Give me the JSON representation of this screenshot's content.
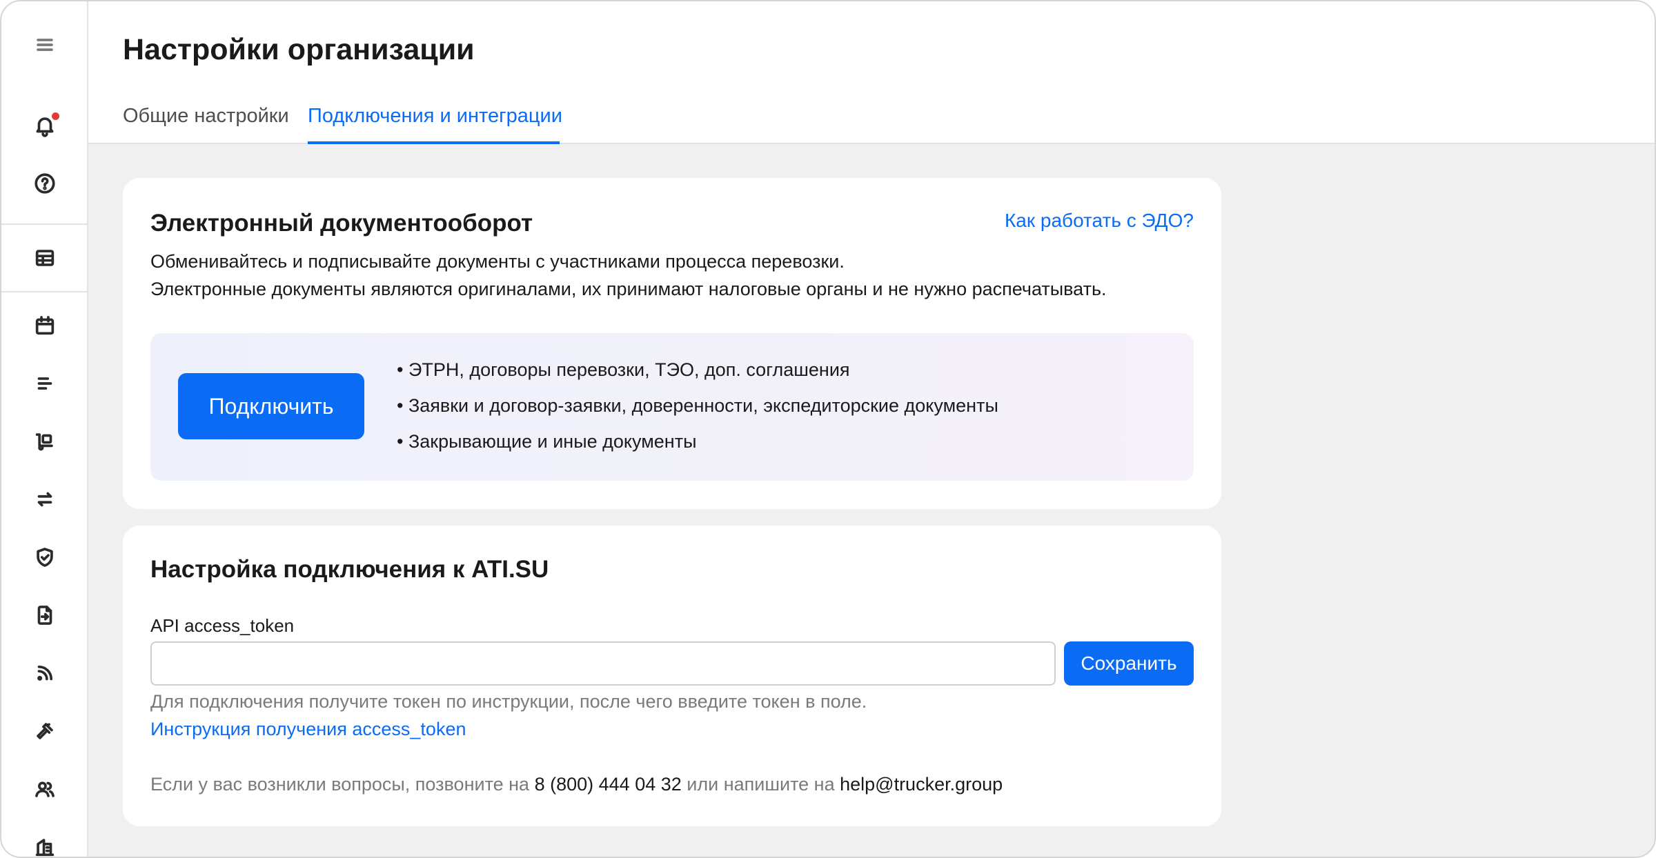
{
  "header": {
    "title": "Настройки организации",
    "tabs": [
      {
        "label": "Общие настройки",
        "active": false
      },
      {
        "label": "Подключения и интеграции",
        "active": true
      }
    ]
  },
  "sidebar": {
    "icons": [
      "menu-icon",
      "bell-icon",
      "help-circle-icon",
      "table-icon",
      "calendar-icon",
      "list-icon",
      "cargo-icon",
      "transfer-icon",
      "shield-check-icon",
      "document-export-icon",
      "rss-icon",
      "gavel-icon",
      "users-icon",
      "building-icon"
    ],
    "notification_dot": true
  },
  "edo": {
    "title": "Электронный документооборот",
    "help_link": "Как работать с ЭДО?",
    "desc_line1": "Обменивайтесь и подписывайте документы с участниками процесса перевозки.",
    "desc_line2": "Электронные документы являются оригиналами, их принимают налоговые органы и не нужно распечатывать.",
    "connect_label": "Подключить",
    "bullets": [
      "• ЭТРН, договоры перевозки, ТЭО, доп. соглашения",
      "• Заявки и договор-заявки, доверенности, экспедиторские документы",
      "• Закрывающие и иные документы"
    ]
  },
  "ati": {
    "title": "Настройка подключения к ATI.SU",
    "field_label": "API access_token",
    "token_value": "",
    "save_label": "Сохранить",
    "hint": "Для подключения получите токен по инструкции, после чего введите токен в поле.",
    "instruction_link": "Инструкция получения access_token",
    "contact_prefix": "Если у вас возникли вопросы, позвоните на",
    "phone": "8 (800) 444 04 32",
    "contact_middle": "или напишите на",
    "email": "help@trucker.group"
  },
  "colors": {
    "accent": "#0a6cf5",
    "background": "#f0f0f0",
    "notification": "#e53935"
  }
}
